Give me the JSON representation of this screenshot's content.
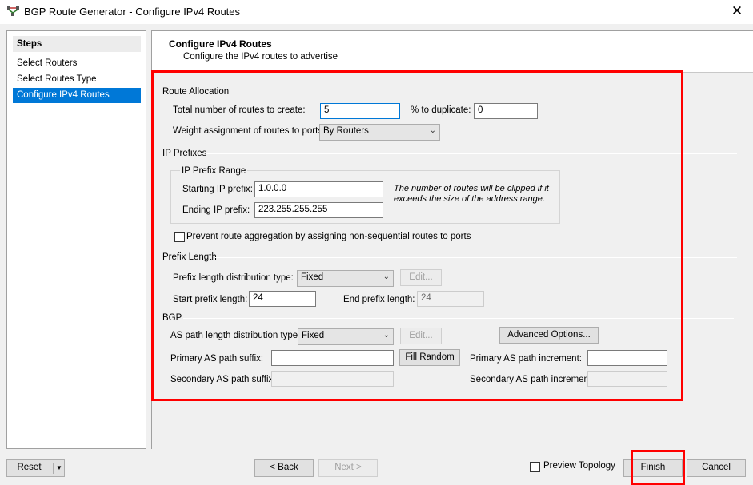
{
  "window": {
    "title": "BGP Route Generator - Configure IPv4 Routes",
    "close_glyph": "✕"
  },
  "steps": {
    "header": "Steps",
    "items": [
      {
        "label": "Select Routers"
      },
      {
        "label": "Select Routes Type"
      },
      {
        "label": "Configure IPv4 Routes"
      }
    ]
  },
  "page": {
    "title": "Configure IPv4 Routes",
    "subtitle": "Configure the IPv4 routes to advertise"
  },
  "route_allocation": {
    "section_label": "Route Allocation",
    "total_label": "Total number of routes to create:",
    "total_value": "5",
    "dup_label": "% to duplicate:",
    "dup_value": "0",
    "weight_label": "Weight assignment of routes to ports:",
    "weight_value": "By Routers"
  },
  "ip_prefixes": {
    "section_label": "IP Prefixes",
    "range_label": "IP Prefix Range",
    "start_label": "Starting IP prefix:",
    "start_value": "1.0.0.0",
    "end_label": "Ending IP prefix:",
    "end_value": "223.255.255.255",
    "note_line1": "The number of routes will be clipped if it",
    "note_line2": "exceeds the size of the address range.",
    "prevent_label": "Prevent route aggregation by assigning non-sequential routes to ports",
    "prevent_checked": false
  },
  "prefix_length": {
    "section_label": "Prefix Length",
    "dist_label": "Prefix length distribution type:",
    "dist_value": "Fixed",
    "edit_label": "Edit...",
    "start_label": "Start prefix length:",
    "start_value": "24",
    "end_label": "End prefix length:",
    "end_value": "24"
  },
  "bgp": {
    "section_label": "BGP",
    "as_dist_label": "AS path length distribution type:",
    "as_dist_value": "Fixed",
    "edit_label": "Edit...",
    "advanced_label": "Advanced Options...",
    "primary_suffix_label": "Primary AS path suffix:",
    "primary_suffix_value": "",
    "fill_random_label": "Fill Random",
    "primary_increment_label": "Primary AS path increment:",
    "primary_increment_value": "",
    "secondary_suffix_label": "Secondary AS path suffix:",
    "secondary_suffix_value": "",
    "secondary_increment_label": "Secondary AS path increment",
    "secondary_increment_value": ""
  },
  "footer": {
    "reset_label": "Reset",
    "back_label": "< Back",
    "next_label": "Next >",
    "preview_label": "Preview Topology",
    "preview_checked": false,
    "finish_label": "Finish",
    "cancel_label": "Cancel"
  },
  "colors": {
    "highlight": "#ff0000",
    "selected": "#0078d7"
  }
}
